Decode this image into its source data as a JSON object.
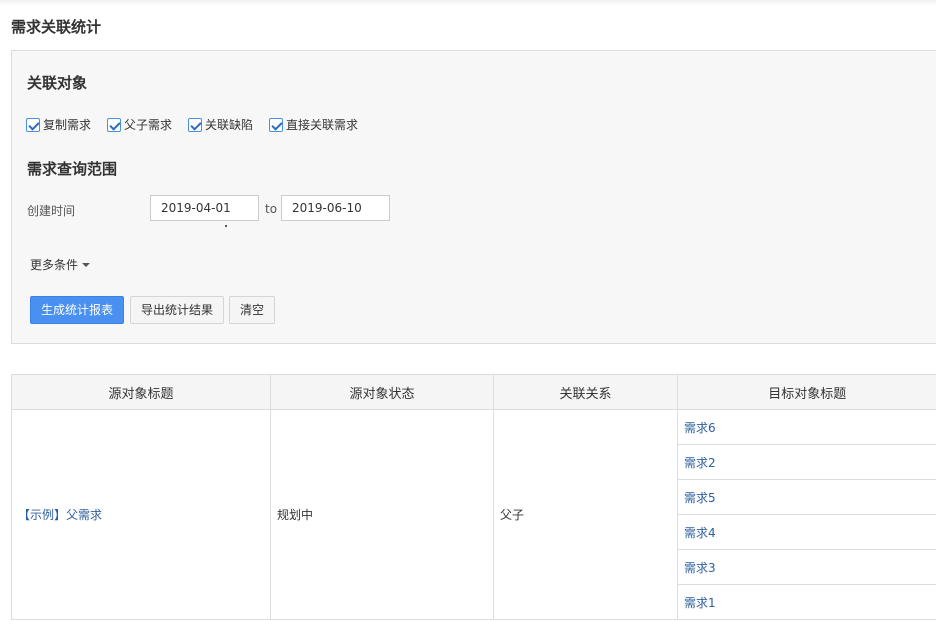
{
  "page": {
    "title": "需求关联统计"
  },
  "filter": {
    "relation_section_title": "关联对象",
    "checkboxes": [
      {
        "label": "复制需求",
        "checked": true
      },
      {
        "label": "父子需求",
        "checked": true
      },
      {
        "label": "关联缺陷",
        "checked": true
      },
      {
        "label": "直接关联需求",
        "checked": true
      }
    ],
    "range_section_title": "需求查询范围",
    "created_time_label": "创建时间",
    "date_from": "2019-04-01",
    "date_to_sep": "to",
    "date_to": "2019-06-10",
    "more_conditions": "更多条件"
  },
  "buttons": {
    "generate": "生成统计报表",
    "export": "导出统计结果",
    "clear": "清空"
  },
  "table": {
    "headers": [
      "源对象标题",
      "源对象状态",
      "关联关系",
      "目标对象标题"
    ],
    "source_title": "【示例】父需求",
    "source_status": "规划中",
    "relation": "父子",
    "targets": [
      "需求6",
      "需求2",
      "需求5",
      "需求4",
      "需求3",
      "需求1"
    ]
  },
  "colors": {
    "primary": "#4a90f0",
    "link": "#2e5f9e",
    "panel_bg": "#f7f7f7"
  }
}
